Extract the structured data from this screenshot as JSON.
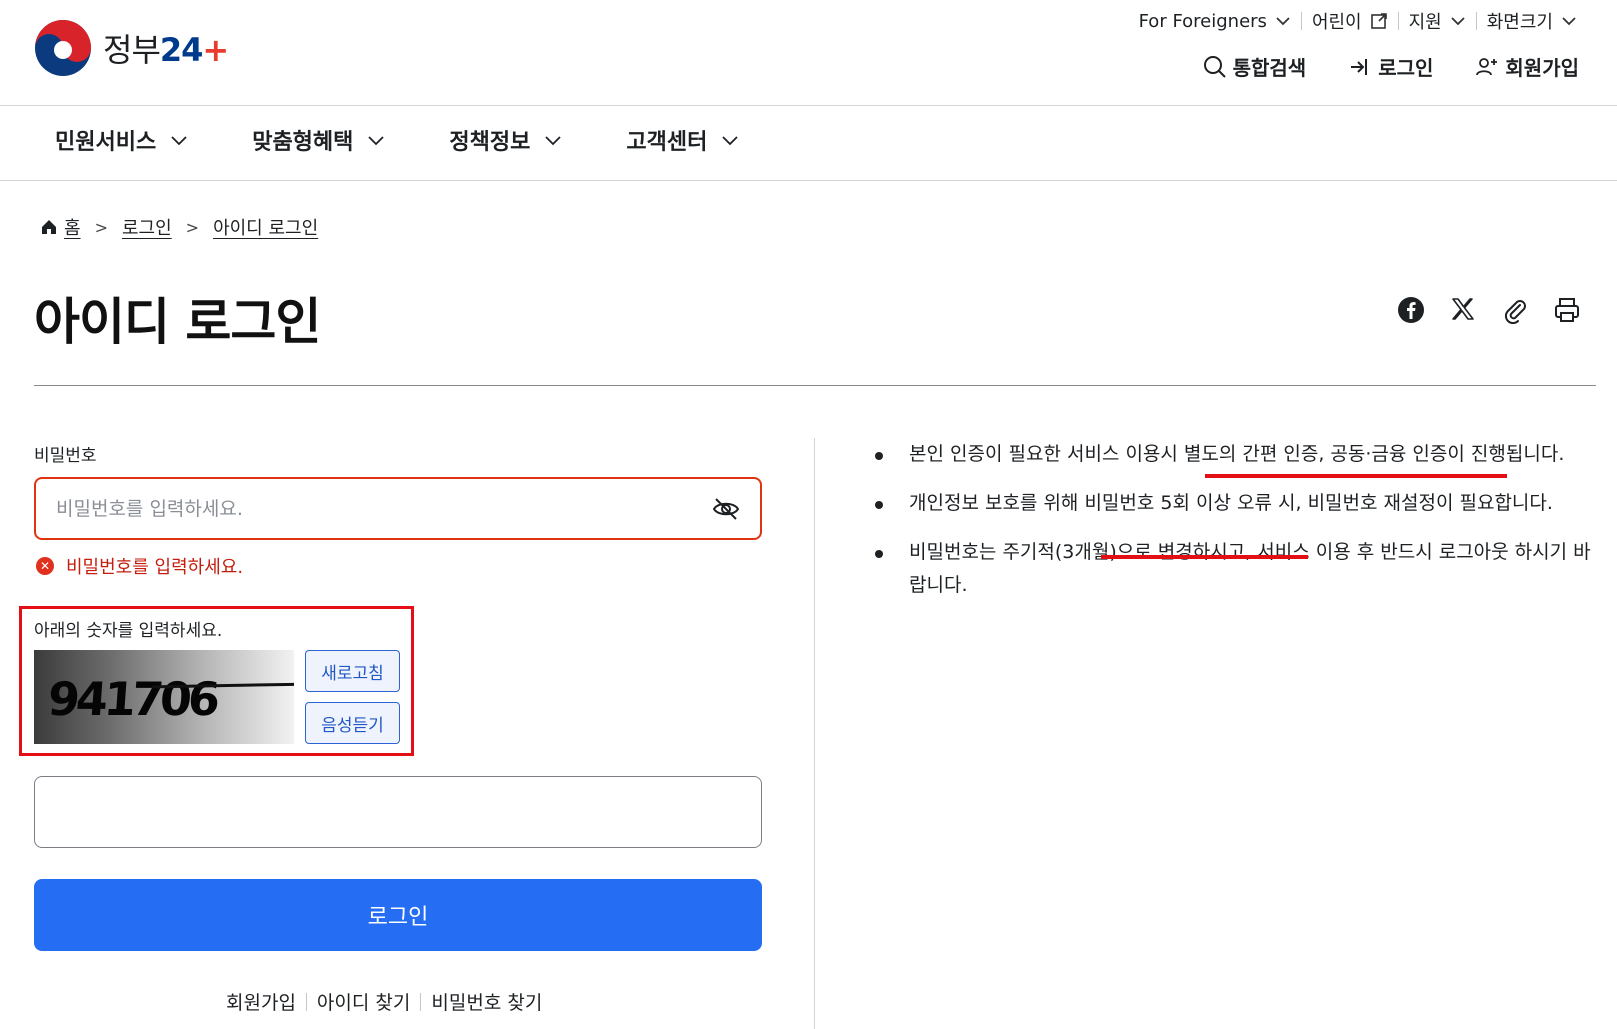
{
  "header": {
    "logo_text": "정부",
    "logo_num": "24",
    "util": [
      {
        "label": "For Foreigners",
        "icon": "chevron-down-icon"
      },
      {
        "label": "어린이",
        "icon": "external-link-icon"
      },
      {
        "label": "지원",
        "icon": "chevron-down-icon"
      },
      {
        "label": "화면크기",
        "icon": "chevron-down-icon"
      }
    ],
    "gnb": [
      {
        "label": "통합검색",
        "icon": "search-icon"
      },
      {
        "label": "로그인",
        "icon": "login-icon"
      },
      {
        "label": "회원가입",
        "icon": "add-user-icon"
      }
    ]
  },
  "menu": [
    "민원서비스",
    "맞춤형혜택",
    "정책정보",
    "고객센터"
  ],
  "breadcrumb": [
    "홈",
    "로그인",
    "아이디 로그인"
  ],
  "page_title": "아이디 로그인",
  "share_icons": [
    "facebook-icon",
    "x-icon",
    "paperclip-icon",
    "print-icon"
  ],
  "form": {
    "password_label": "비밀번호",
    "password_placeholder": "비밀번호를 입력하세요.",
    "password_error": "비밀번호를 입력하세요.",
    "captcha_label": "아래의 숫자를 입력하세요.",
    "captcha_digits": "941706",
    "refresh_label": "새로고침",
    "audio_label": "음성듣기",
    "captcha_value": "",
    "login_label": "로그인"
  },
  "links": [
    "회원가입",
    "아이디 찾기",
    "비밀번호 찾기"
  ],
  "notices": [
    "본인 인증이 필요한 서비스 이용시 별도의 간편 인증, 공동·금융 인증이 진행됩니다.",
    "개인정보 보호를 위해 비밀번호 5회 이상 오류 시, 비밀번호 재설정이 필요합니다.",
    "비밀번호는 주기적(3개월)으로 변경하시고, 서비스 이용 후 반드시 로그아웃 하시기 바랍니다."
  ],
  "colors": {
    "primary": "#256ef4",
    "error": "#de3412",
    "highlight": "#e30f14"
  }
}
